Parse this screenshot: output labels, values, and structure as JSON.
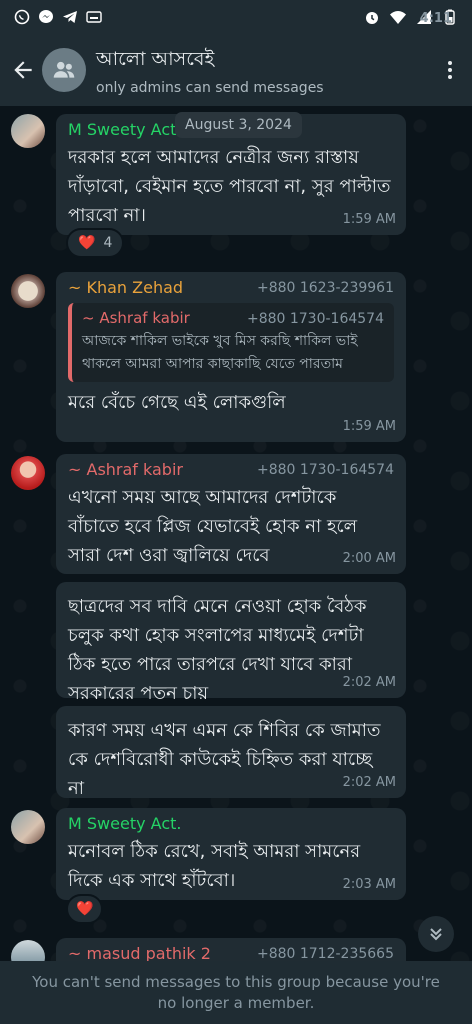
{
  "status_bar": {
    "time": "4:11",
    "left_icons": [
      "whatsapp-icon",
      "messenger-icon",
      "telegram-icon",
      "screen-record-icon"
    ],
    "right_icons": [
      "alarm-icon",
      "wifi-icon",
      "signal-icon",
      "battery-icon"
    ]
  },
  "header": {
    "title": "আলো আসবেই",
    "subtitle": "only admins can send messages"
  },
  "date_chip": "August 3, 2024",
  "messages": [
    {
      "sender": "M Sweety Act",
      "sender_color": "#53bdeb",
      "text": "দরকার হলে আমাদের নেত্রীর জন্য রাস্তায় দাঁড়াবো, বেইমান হতে পারবো না, সুর পাল্টাত পারবো না।",
      "time": "1:59 AM",
      "reaction": {
        "emoji": "❤️",
        "count": "4"
      }
    },
    {
      "sender": "~ Khan Zehad",
      "sender_color": "#e9a23b",
      "phone": "+880 1623-239961",
      "quote": {
        "sender": "~ Ashraf kabir",
        "phone": "+880 1730-164574",
        "text": "আজকে শাকিল ভাইকে খুব মিস করছি শাকিল ভাই থাকলে আমরা আপার কাছাকাছি যেতে পারতাম"
      },
      "text": "মরে বেঁচে গেছে এই লোকগুলি",
      "time": "1:59 AM"
    },
    {
      "sender": "~ Ashraf kabir",
      "sender_color": "#e26a6a",
      "phone": "+880 1730-164574",
      "text": "এখনো সময় আছে আমাদের দেশটাকে বাঁচাতে হবে প্লিজ যেভাবেই হোক না হলে সারা দেশ ওরা জ্বালিয়ে দেবে",
      "time": "2:00 AM"
    },
    {
      "text": "ছাত্রদের সব দাবি মেনে নেওয়া হোক বৈঠক চলুক কথা হোক সংলাপের মাধ্যমেই দেশটা ঠিক হতে পারে তারপরে দেখা যাবে কারা সরকারের পতন চায়",
      "time": "2:02 AM"
    },
    {
      "text": "কারণ সময় এখন এমন কে শিবির কে জামাত কে দেশবিরোধী কাউকেই চিহ্নিত করা যাচ্ছে না",
      "time": "2:02 AM"
    },
    {
      "sender": "M Sweety Act.",
      "sender_color": "#25d366",
      "text": "মনোবল ঠিক রেখে, সবাই আমরা সামনের দিকে এক সাথে হাঁটবো।",
      "time": "2:03 AM",
      "reaction": {
        "emoji": "❤️"
      }
    },
    {
      "sender": "~ masud pathik 2",
      "sender_color": "#e26a6a",
      "phone": "+880 1712-235665"
    }
  ],
  "footer_text": "You can't send messages to this group because you're no longer a member.",
  "colors": {
    "accent": "#25d366",
    "bubble": "#202c33",
    "background": "#0b141a"
  }
}
